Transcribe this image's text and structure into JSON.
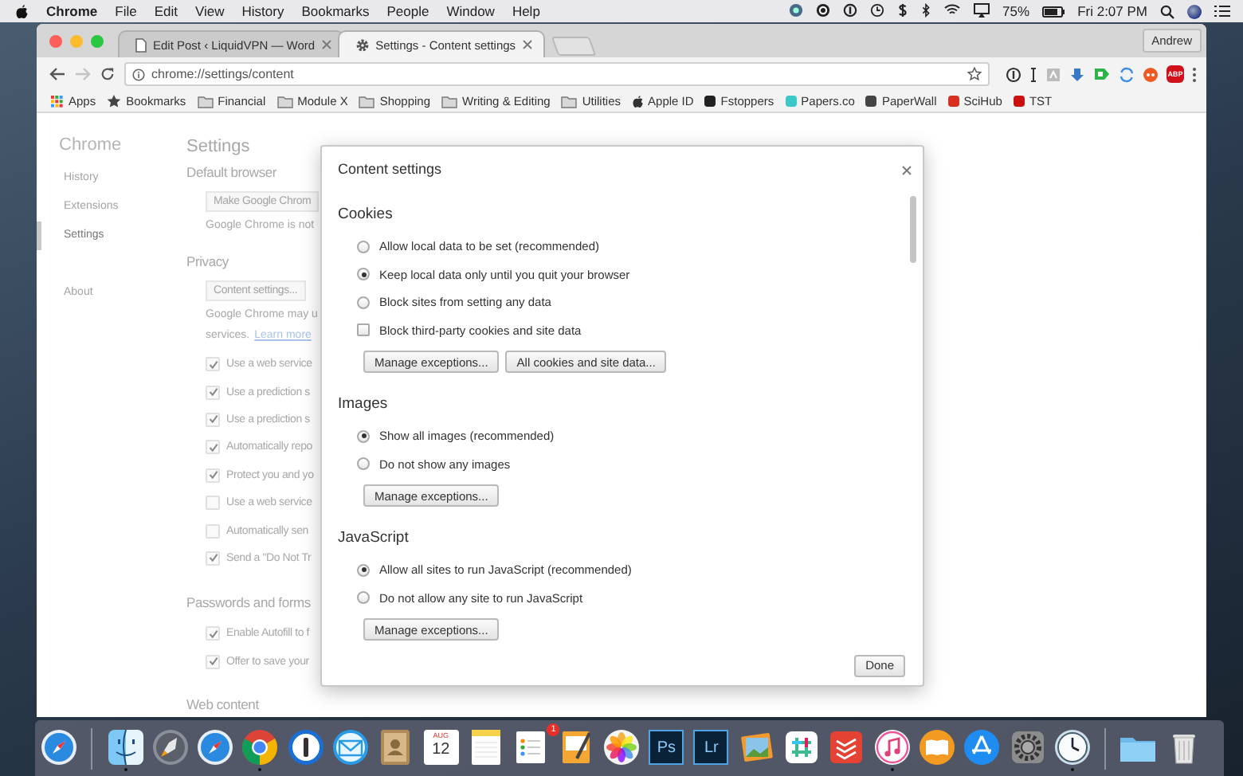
{
  "menu_bar": {
    "app": "Chrome",
    "menus": [
      "File",
      "Edit",
      "View",
      "History",
      "Bookmarks",
      "People",
      "Window",
      "Help"
    ],
    "battery": "75%",
    "clock": "Fri 2:07 PM"
  },
  "tabs": [
    {
      "kind": "document",
      "title": "Edit Post ‹ LiquidVPN — Word",
      "selected": false
    },
    {
      "kind": "settings",
      "title": "Settings - Content settings",
      "selected": true
    }
  ],
  "profile": "Andrew",
  "omnibox": {
    "url": "chrome://settings/content"
  },
  "adblock": "ABP",
  "bookmarks": [
    {
      "kind": "apps",
      "label": "Apps"
    },
    {
      "kind": "star",
      "label": "Bookmarks"
    },
    {
      "kind": "folder",
      "label": "Financial"
    },
    {
      "kind": "folder",
      "label": "Module X"
    },
    {
      "kind": "folder",
      "label": "Shopping"
    },
    {
      "kind": "folder",
      "label": "Writing & Editing"
    },
    {
      "kind": "folder",
      "label": "Utilities"
    },
    {
      "kind": "apple",
      "label": "Apple ID"
    },
    {
      "kind": "site",
      "label": "Fstoppers",
      "color": "#222222"
    },
    {
      "kind": "site",
      "label": "Papers.co",
      "color": "#3cc8c8"
    },
    {
      "kind": "site",
      "label": "PaperWall",
      "color": "#444444"
    },
    {
      "kind": "site",
      "label": "SciHub",
      "color": "#d83020"
    },
    {
      "kind": "site",
      "label": "TST",
      "color": "#cc1010"
    }
  ],
  "sidebar": {
    "title": "Chrome",
    "items": [
      {
        "label": "History",
        "selected": false
      },
      {
        "label": "Extensions",
        "selected": false
      },
      {
        "label": "Settings",
        "selected": true
      },
      {
        "label": "About",
        "selected": false
      }
    ]
  },
  "settings_page": {
    "title": "Settings",
    "default_browser": {
      "heading": "Default browser",
      "button": "Make Google Chrom",
      "note": "Google Chrome is not"
    },
    "privacy": {
      "heading": "Privacy",
      "button": "Content settings...",
      "note": "Google Chrome may u",
      "note_2": "services.",
      "link": "Learn more",
      "checks": [
        {
          "label": "Use a web service",
          "checked": true
        },
        {
          "label": "Use a prediction s",
          "checked": true
        },
        {
          "label": "Use a prediction s",
          "checked": true
        },
        {
          "label": "Automatically repo",
          "checked": true
        },
        {
          "label": "Protect you and yo",
          "checked": true
        },
        {
          "label": "Use a web service",
          "checked": false
        },
        {
          "label": "Automatically sen",
          "checked": false
        },
        {
          "label": "Send a \"Do Not Tr",
          "checked": true
        }
      ]
    },
    "passwords": {
      "heading": "Passwords and forms",
      "checks": [
        {
          "label": "Enable Autofill to f",
          "checked": true
        },
        {
          "label": "Offer to save your",
          "checked": true
        }
      ]
    },
    "web_content": {
      "heading": "Web content"
    }
  },
  "dialog": {
    "title": "Content settings",
    "sections": [
      {
        "heading": "Cookies",
        "options": [
          {
            "kind": "radio",
            "label": "Allow local data to be set (recommended)",
            "selected": false
          },
          {
            "kind": "radio",
            "label": "Keep local data only until you quit your browser",
            "selected": true
          },
          {
            "kind": "radio",
            "label": "Block sites from setting any data",
            "selected": false
          },
          {
            "kind": "checkbox",
            "label": "Block third-party cookies and site data",
            "checked": false
          }
        ],
        "buttons": [
          "Manage exceptions...",
          "All cookies and site data..."
        ]
      },
      {
        "heading": "Images",
        "options": [
          {
            "kind": "radio",
            "label": "Show all images (recommended)",
            "selected": true
          },
          {
            "kind": "radio",
            "label": "Do not show any images",
            "selected": false
          }
        ],
        "buttons": [
          "Manage exceptions..."
        ]
      },
      {
        "heading": "JavaScript",
        "options": [
          {
            "kind": "radio",
            "label": "Allow all sites to run JavaScript (recommended)",
            "selected": true
          },
          {
            "kind": "radio",
            "label": "Do not allow any site to run JavaScript",
            "selected": false
          }
        ],
        "buttons": [
          "Manage exceptions..."
        ]
      }
    ],
    "done": "Done"
  },
  "dock": {
    "pinned": [
      {
        "kind": "compass",
        "running": false
      }
    ],
    "apps": [
      {
        "kind": "finder",
        "running": true
      },
      {
        "kind": "rocket",
        "running": false
      },
      {
        "kind": "compass",
        "running": false
      },
      {
        "kind": "chrome",
        "running": true
      },
      {
        "kind": "keyhole",
        "running": false
      },
      {
        "kind": "envelope",
        "running": false
      },
      {
        "kind": "contacts",
        "running": false
      },
      {
        "kind": "calendar",
        "month": "AUG",
        "day": "12",
        "running": false
      },
      {
        "kind": "notepad",
        "running": false
      },
      {
        "kind": "reminders",
        "badge": "1",
        "running": false
      },
      {
        "kind": "pen",
        "running": false
      },
      {
        "kind": "flower",
        "running": false
      },
      {
        "kind": "tile",
        "label": "Ps",
        "running": false
      },
      {
        "kind": "tile",
        "label": "Lr",
        "running": false
      },
      {
        "kind": "photos",
        "running": false
      },
      {
        "kind": "hash",
        "running": false
      },
      {
        "kind": "stack",
        "running": false
      },
      {
        "kind": "note",
        "running": true
      },
      {
        "kind": "book",
        "running": false
      },
      {
        "kind": "store",
        "running": false
      },
      {
        "kind": "gear",
        "running": false
      },
      {
        "kind": "clock",
        "running": true
      }
    ],
    "stacks": [
      {
        "kind": "folder",
        "running": false
      },
      {
        "kind": "trash",
        "running": false
      }
    ]
  }
}
